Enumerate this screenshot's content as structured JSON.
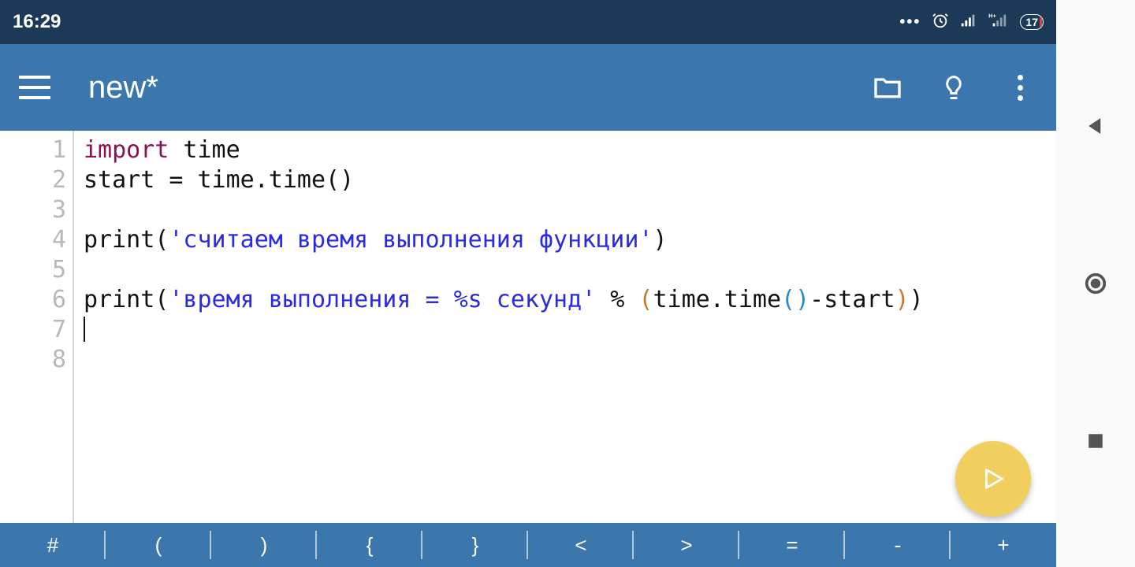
{
  "status": {
    "time": "16:29",
    "battery": "17"
  },
  "appbar": {
    "title": "new*"
  },
  "gutter": [
    "1",
    "2",
    "3",
    "4",
    "5",
    "6",
    "7",
    "8"
  ],
  "code": {
    "l1_kw": "import",
    "l1_rest": " time",
    "l2": "start = time.time()",
    "l3": "",
    "l4_pre": "print(",
    "l4_str": "'считаем время выполнения функции'",
    "l4_post": ")",
    "l5": "",
    "l6_pre": "print(",
    "l6_str": "'время выполнения = %s секунд'",
    "l6_mid": " % ",
    "l6_p1o": "(",
    "l6_call": "time.time",
    "l6_p2o": "(",
    "l6_p2c": ")",
    "l6_rest": "-start",
    "l6_p1c": ")",
    "l6_post": ")",
    "l7": "",
    "l8": ""
  },
  "symbols": [
    "#",
    "(",
    ")",
    "{",
    "}",
    "<",
    ">",
    "=",
    "-",
    "+"
  ],
  "icons": {
    "hamburger": "menu-icon",
    "folder": "folder-icon",
    "bulb": "lightbulb-icon",
    "more": "more-vert-icon",
    "run": "play-icon",
    "alarm": "alarm-icon",
    "signal1": "signal-icon",
    "signal2": "signal-h-icon",
    "nav_back": "nav-back-icon",
    "nav_home": "nav-home-icon",
    "nav_recent": "nav-recent-icon"
  }
}
